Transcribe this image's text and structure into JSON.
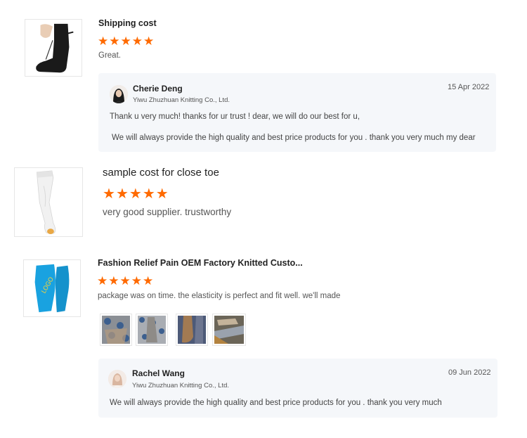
{
  "reviews": [
    {
      "title": "Shipping cost",
      "rating": 5,
      "stars": [
        "★",
        "★",
        "★",
        "★",
        "★"
      ],
      "comment": "Great.",
      "thumbnail_icon": "black-knee-sock-icon",
      "reply": {
        "name": "Cherie Deng",
        "company": "Yiwu Zhuzhuan Knitting Co., Ltd.",
        "date": "15 Apr 2022",
        "lines": [
          "Thank u very much! thanks for ur trust ! dear, we will do our best for u,",
          "We will always  provide the high quality and best price products for you . thank you very much  my dear"
        ]
      }
    },
    {
      "title": "sample cost for close toe",
      "rating": 5,
      "stars": [
        "★",
        "★",
        "★",
        "★",
        "★"
      ],
      "comment": "very good supplier.  trustworthy",
      "thumbnail_icon": "white-thigh-high-stocking-icon"
    },
    {
      "title": "Fashion Relief Pain OEM Factory Knitted Custo...",
      "rating": 5,
      "stars": [
        "★",
        "★",
        "★",
        "★",
        "★"
      ],
      "comment": "package was on time. the elasticity is perfect and fit well. we'll made",
      "thumbnail_icon": "blue-calf-sleeve-icon",
      "thumbnail_logo_text": "LOGO",
      "photos": [
        "photo-1",
        "photo-2",
        "photo-3",
        "photo-4"
      ],
      "reply": {
        "name": "Rachel Wang",
        "company": "Yiwu Zhuzhuan Knitting Co., Ltd.",
        "date": "09 Jun 2022",
        "lines": [
          "We will always  provide the high quality and best price products for you . thank you very much"
        ]
      }
    }
  ],
  "colors": {
    "star": "#ff6a00",
    "reply_background": "#f5f7fa"
  }
}
